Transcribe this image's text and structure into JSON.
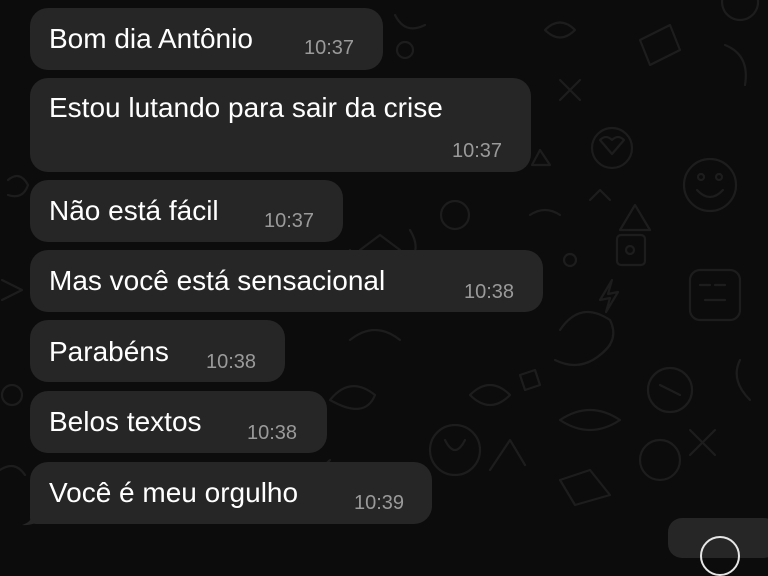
{
  "messages": [
    {
      "text": "Bom dia Antônio",
      "time": "10:37"
    },
    {
      "text": "Estou lutando para sair da crise",
      "time": "10:37"
    },
    {
      "text": "Não está fácil",
      "time": "10:37"
    },
    {
      "text": "Mas você está sensacional",
      "time": "10:38"
    },
    {
      "text": "Parabéns",
      "time": "10:38"
    },
    {
      "text": "Belos textos",
      "time": "10:38"
    },
    {
      "text": "Você é meu orgulho",
      "time": "10:39"
    }
  ],
  "colors": {
    "background": "#0c0c0c",
    "bubble": "#262626",
    "message_text": "#ffffff",
    "timestamp_text": "#9a9a9a",
    "wallpaper_doodles": "#1c1c1c"
  },
  "icons": [
    "chat-wallpaper-doodles",
    "scroll-down-icon"
  ]
}
